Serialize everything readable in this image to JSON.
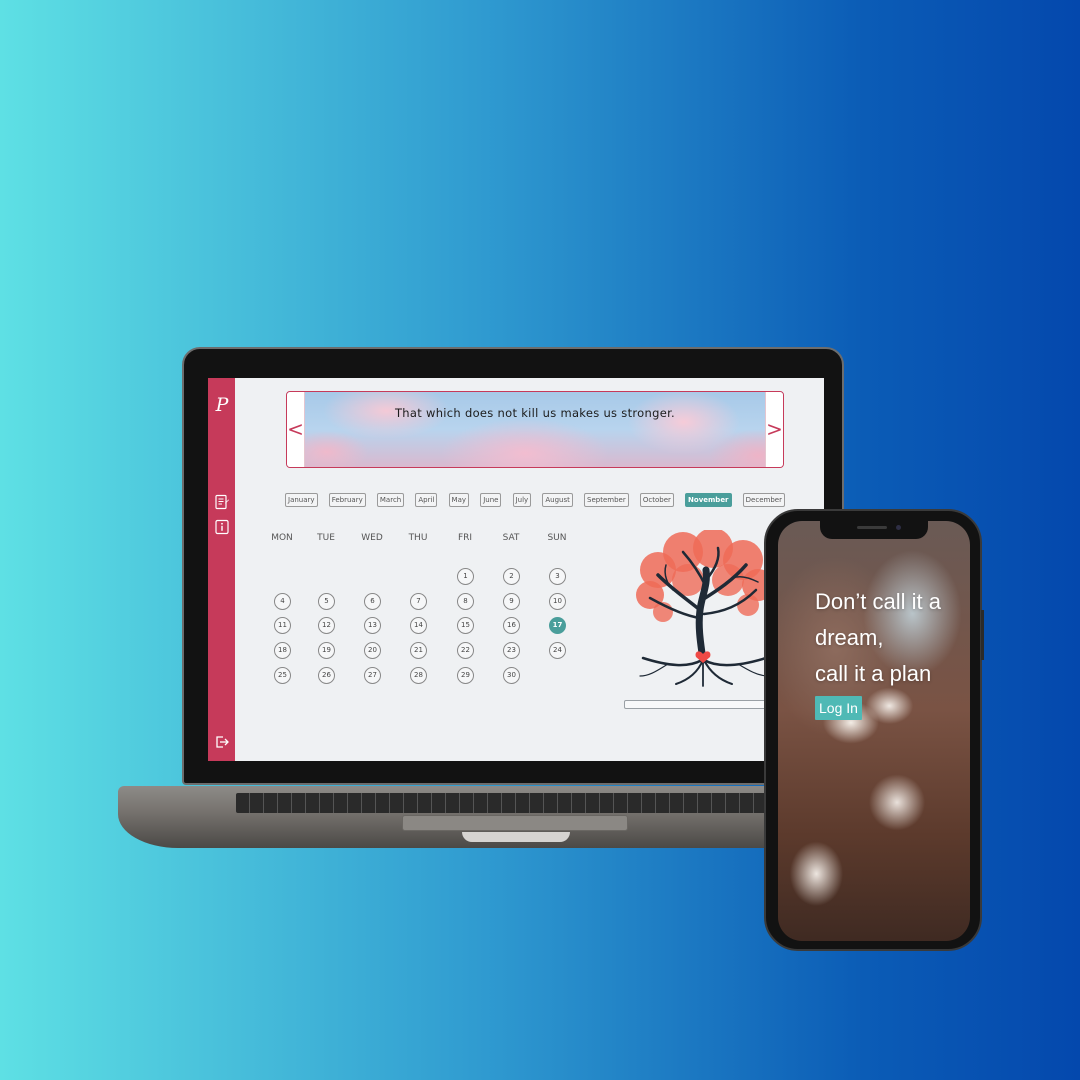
{
  "banner": {
    "quote": "That which does not kill us makes us stronger.",
    "prev": "<",
    "next": ">"
  },
  "sidebar": {
    "logo": "P",
    "icons": [
      "notes-icon",
      "info-icon",
      "logout-icon"
    ]
  },
  "months": [
    "January",
    "February",
    "March",
    "April",
    "May",
    "June",
    "July",
    "August",
    "September",
    "October",
    "November",
    "December"
  ],
  "active_month": "November",
  "weekdays": [
    "MON",
    "TUE",
    "WED",
    "THU",
    "FRI",
    "SAT",
    "SUN"
  ],
  "days": [
    [
      "",
      "",
      "",
      "",
      "1",
      "2",
      "3"
    ],
    [
      "4",
      "5",
      "6",
      "7",
      "8",
      "9",
      "10"
    ],
    [
      "11",
      "12",
      "13",
      "14",
      "15",
      "16",
      "17"
    ],
    [
      "18",
      "19",
      "20",
      "21",
      "22",
      "23",
      "24"
    ],
    [
      "25",
      "26",
      "27",
      "28",
      "29",
      "30",
      ""
    ]
  ],
  "today": "17",
  "colors": {
    "brand": "#c63a5a",
    "accent": "#4a9e9b",
    "login": "#4fb9b5"
  },
  "phone": {
    "headline_lines": [
      "Don’t call it a",
      "dream,",
      "call it a plan"
    ],
    "login_label": "Log In"
  }
}
